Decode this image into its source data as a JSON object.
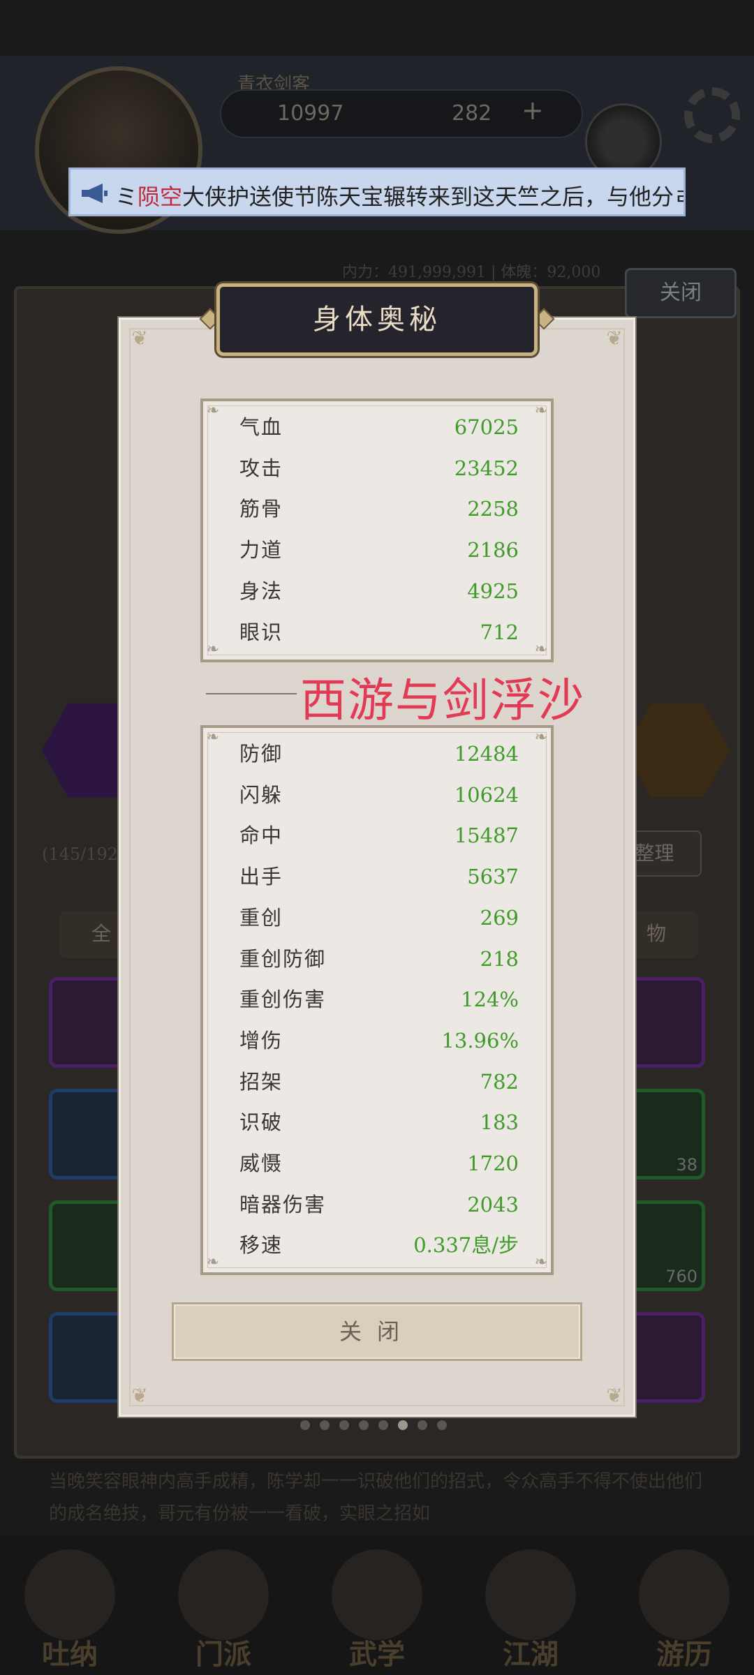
{
  "background": {
    "user_name": "青衣剑客",
    "currency": {
      "coins": "10997",
      "jade": "282",
      "add": "+"
    },
    "header_stats": "内力：491,999,991 | 体魄：92,000",
    "close_label": "关闭",
    "left_label": "(145/192)",
    "organize_label": "整理",
    "tab_all": "全",
    "tab_items": "物",
    "slot_counts": [
      "38",
      "760"
    ],
    "description": "当晚笑容眼神内高手成精，陈学却一一识破他们的招式，令众高手不得不使出他们的成名绝技，哥元有份被一一看破，实眼之招如",
    "nav": [
      "吐纳",
      "门派",
      "武学",
      "江湖",
      "游历"
    ]
  },
  "ticker": {
    "highlight": "陨空",
    "prefix": "ミ",
    "text": "大侠护送使节陈天宝辗转来到这天竺之后，与他分ㄹ"
  },
  "modal": {
    "title": "身体奥秘",
    "basic_stats": [
      {
        "label": "气血",
        "value": "67025"
      },
      {
        "label": "攻击",
        "value": "23452"
      },
      {
        "label": "筋骨",
        "value": "2258"
      },
      {
        "label": "力道",
        "value": "2186"
      },
      {
        "label": "身法",
        "value": "4925"
      },
      {
        "label": "眼识",
        "value": "712"
      }
    ],
    "advanced_stats": [
      {
        "label": "防御",
        "value": "12484"
      },
      {
        "label": "闪躲",
        "value": "10624"
      },
      {
        "label": "命中",
        "value": "15487"
      },
      {
        "label": "出手",
        "value": "5637"
      },
      {
        "label": "重创",
        "value": "269"
      },
      {
        "label": "重创防御",
        "value": "218"
      },
      {
        "label": "重创伤害",
        "value": "124%"
      },
      {
        "label": "增伤",
        "value": "13.96%"
      },
      {
        "label": "招架",
        "value": "782"
      },
      {
        "label": "识破",
        "value": "183"
      },
      {
        "label": "威慑",
        "value": "1720"
      },
      {
        "label": "暗器伤害",
        "value": "2043"
      },
      {
        "label": "移速",
        "value": "0.337息/步"
      }
    ],
    "watermark": "西游与剑浮沙",
    "close_button": "关闭"
  },
  "pagination": {
    "total": 8,
    "active": 5
  },
  "colors": {
    "stat_value": "#3f9a2a",
    "watermark": "#e23a55",
    "ticker_highlight": "#c0293b",
    "title_plate": "#25232b",
    "title_border": "#c9b383"
  }
}
